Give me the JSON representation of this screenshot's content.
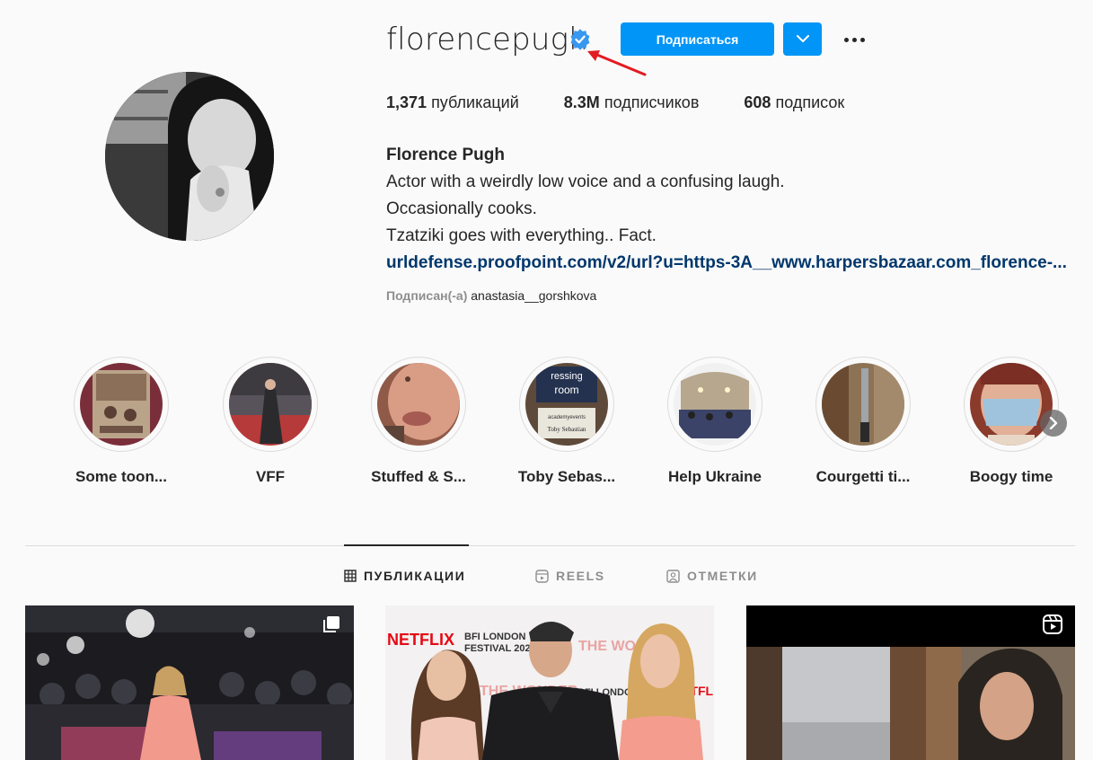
{
  "profile": {
    "username": "florencepugh",
    "follow_label": "Подписаться",
    "posts_count": "1,371",
    "posts_label": "публикаций",
    "followers_count": "8.3M",
    "followers_label": "подписчиков",
    "following_count": "608",
    "following_label": "подписок",
    "full_name": "Florence Pugh",
    "bio_lines": [
      "Actor with a weirdly low voice and a confusing laugh.",
      "Occasionally cooks.",
      "Tzatziki goes with everything.. Fact."
    ],
    "link": "urldefense.proofpoint.com/v2/url?u=https-3A__www.harpersbazaar.com_florence-...",
    "followed_by_prefix": "Подписан(-а)",
    "followed_by_user": "anastasia__gorshkova"
  },
  "highlights": [
    {
      "label": "Some toon..."
    },
    {
      "label": "VFF"
    },
    {
      "label": "Stuffed & S..."
    },
    {
      "label": "Toby Sebas..."
    },
    {
      "label": "Help Ukraine"
    },
    {
      "label": "Courgetti ti..."
    },
    {
      "label": "Boogy time"
    }
  ],
  "highlight_image_text": {
    "toby_top": "ressing",
    "toby_room": "room",
    "toby_small": "academyevents",
    "toby_name": "Toby Sebastian"
  },
  "tabs": [
    {
      "label": "ПУБЛИКАЦИИ",
      "icon": "grid-icon",
      "active": true
    },
    {
      "label": "REELS",
      "icon": "reels-icon",
      "active": false
    },
    {
      "label": "ОТМЕТКИ",
      "icon": "tagged-icon",
      "active": false
    }
  ],
  "post_image_text": {
    "netflix": "NETFLIX",
    "bfi_1": "BFI LONDON",
    "bfi_2": "FESTIVAL 2022",
    "wonder": "THE WONDER"
  },
  "colors": {
    "accent": "#0095f6",
    "verified": "#3897f0",
    "annotation_arrow": "#e31b23",
    "link": "#00376b"
  }
}
